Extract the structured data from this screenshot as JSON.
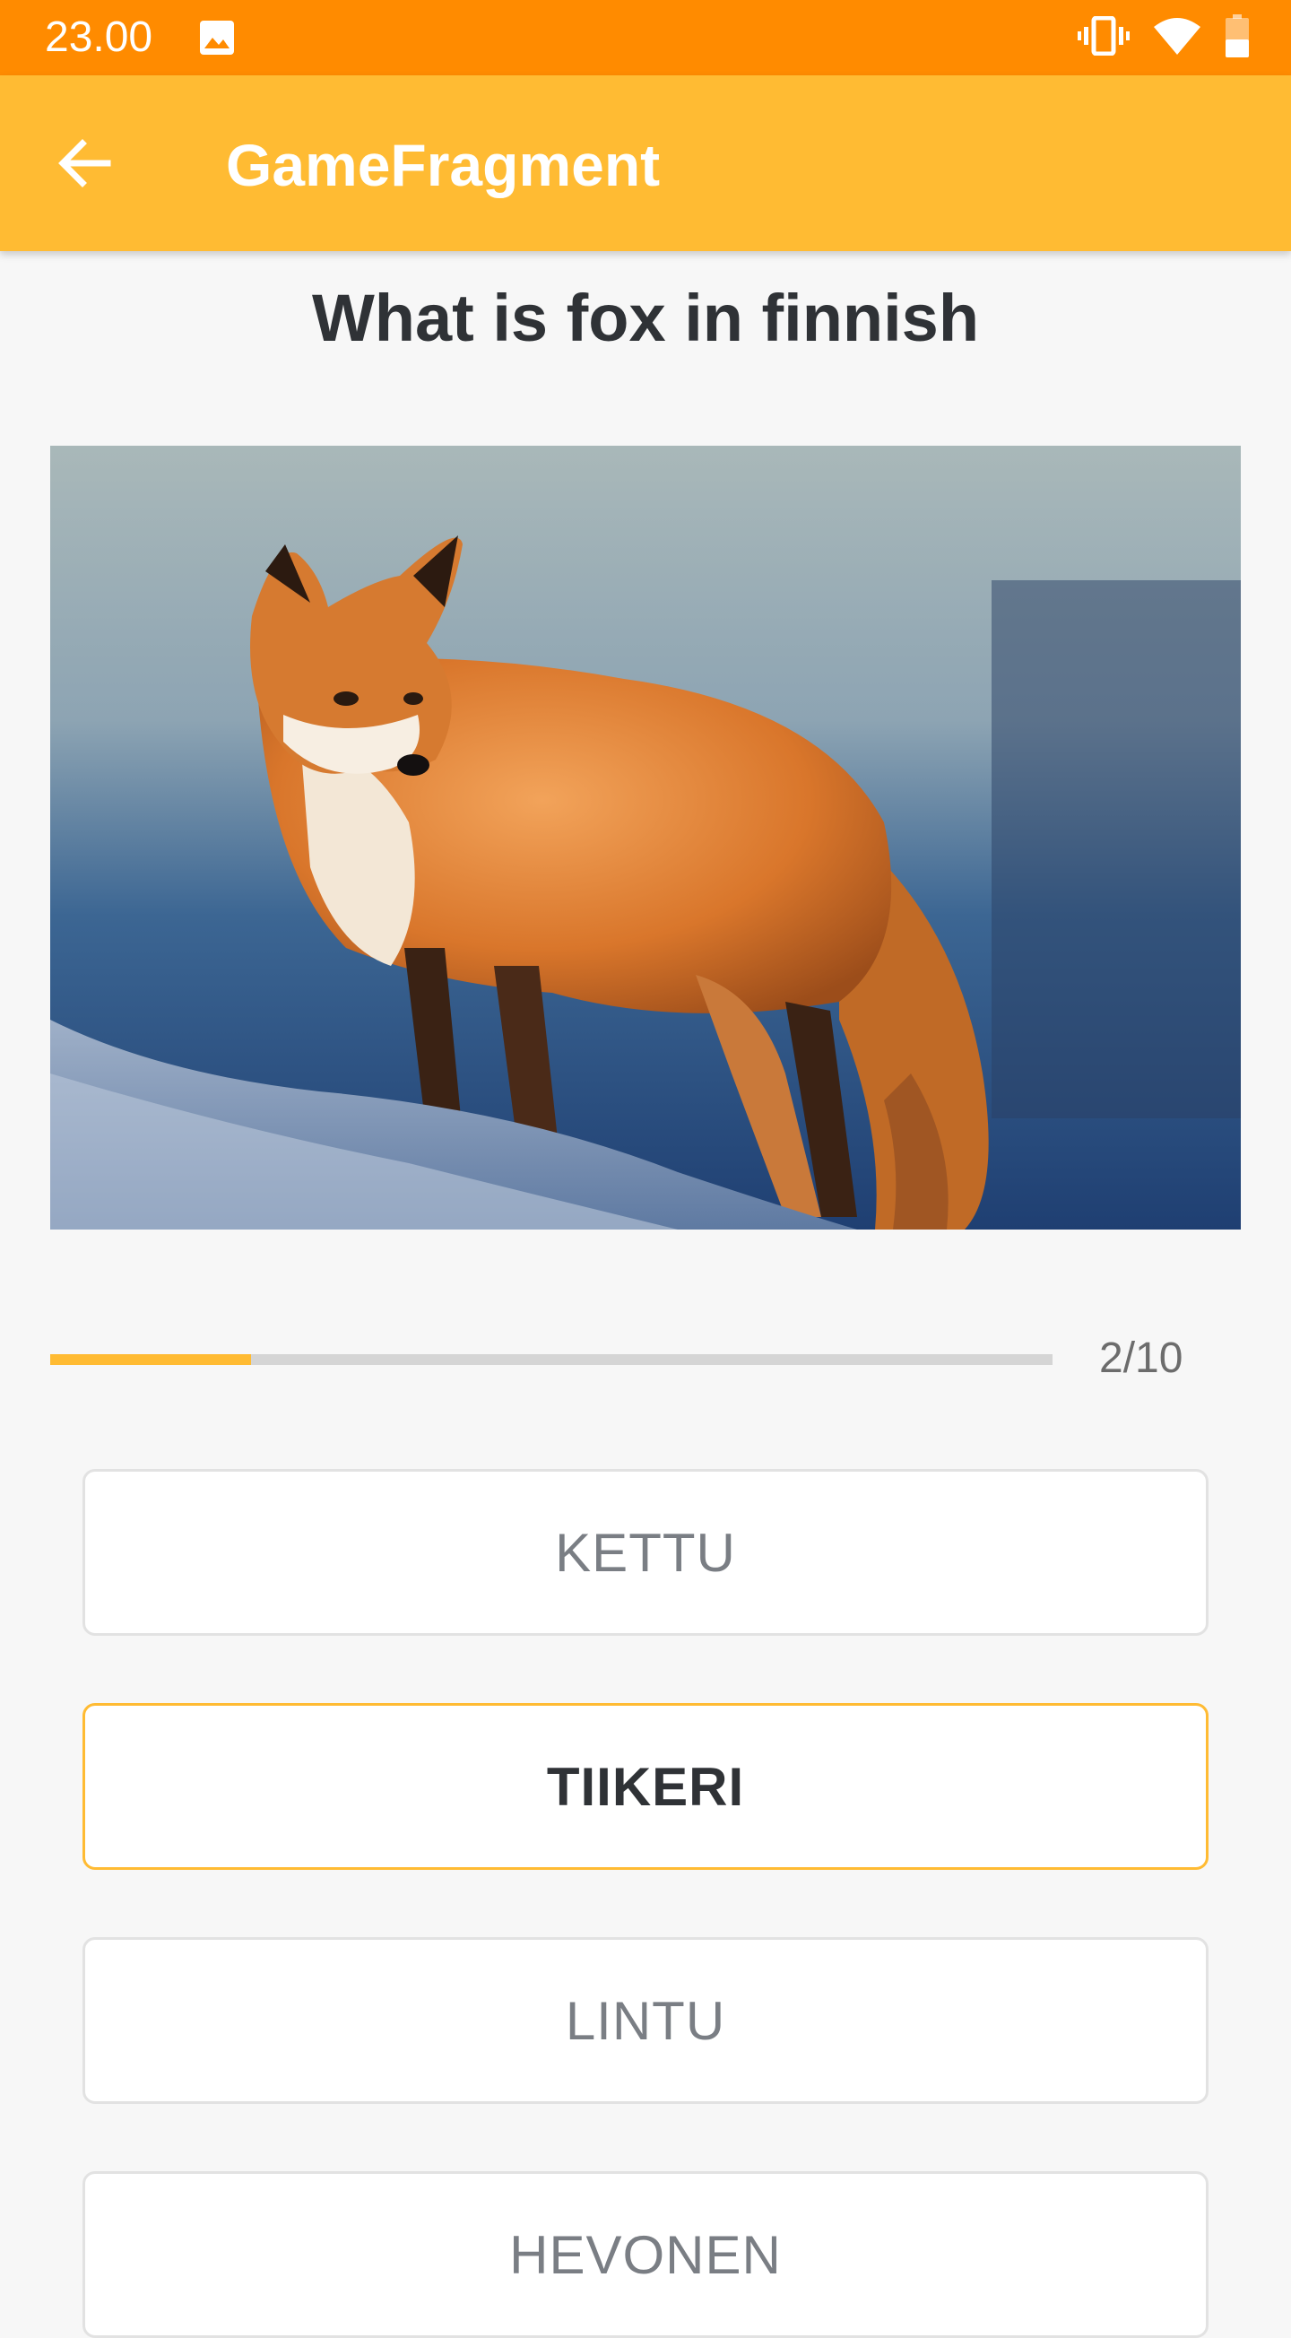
{
  "status_bar": {
    "time": "23.00",
    "icons": [
      "gallery-icon",
      "vibrate-icon",
      "wifi-icon",
      "battery-icon"
    ],
    "color": "#ff8b00"
  },
  "app_bar": {
    "title": "GameFragment",
    "back_icon": "arrow-back-icon",
    "color": "#ffbb33"
  },
  "question": "What is fox in finnish",
  "image": {
    "subject": "fox-photo"
  },
  "progress": {
    "current": 2,
    "total": 10,
    "label": "2/10",
    "fraction": 0.2
  },
  "answers": [
    {
      "label": "KETTU",
      "selected": false
    },
    {
      "label": "TIIKERI",
      "selected": true
    },
    {
      "label": "LINTU",
      "selected": false
    },
    {
      "label": "HEVONEN",
      "selected": false
    }
  ]
}
